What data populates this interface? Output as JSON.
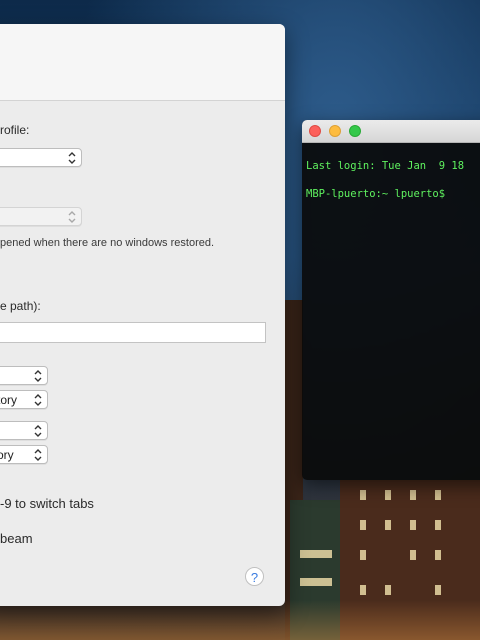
{
  "preferences": {
    "profile_label": "rofile:",
    "profile_value": "",
    "startup_value": "",
    "restore_note": "pened when there are no windows restored.",
    "path_label": "e path):",
    "path_value": "",
    "popups": [
      {
        "value": ""
      },
      {
        "value": "tory"
      },
      {
        "value": ""
      },
      {
        "value": "ory"
      }
    ],
    "switch_tabs_label": "-9 to switch tabs",
    "cursor_label": "beam",
    "help_glyph": "?"
  },
  "terminal": {
    "line1": "Last login: Tue Jan  9 18",
    "line2": "MBP-lpuerto:~ lpuerto$ "
  },
  "colors": {
    "terminal_text": "#5ff25f",
    "window_bg": "#ececec"
  }
}
